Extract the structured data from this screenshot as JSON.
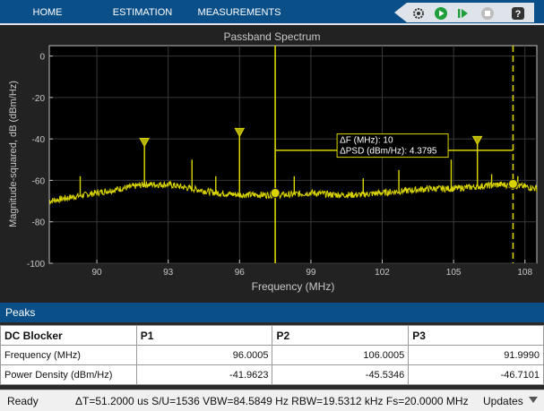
{
  "toolstrip": {
    "tabs": [
      "HOME",
      "ESTIMATION",
      "MEASUREMENTS"
    ],
    "quick_access": [
      "settings-icon",
      "run-icon",
      "step-forward-icon",
      "stop-icon",
      "help-icon"
    ]
  },
  "plot": {
    "title": "Passband Spectrum",
    "ylabel": "Magnitude-squared, dB (dBm/Hz)",
    "xlabel": "Frequency (MHz)",
    "delta_f_label": "ΔF (MHz): 10",
    "delta_psd_label": "ΔPSD (dBm/Hz): 4.3795",
    "colors": {
      "trace": "#d9d400",
      "axes": "#bfbfbf",
      "grid": "#3a3a3a",
      "background": "#000000"
    }
  },
  "chart_data": {
    "type": "line",
    "title": "Passband Spectrum",
    "xlabel": "Frequency (MHz)",
    "ylabel": "Magnitude-squared, dB (dBm/Hz)",
    "xlim": [
      88,
      108.5
    ],
    "ylim": [
      -100,
      5
    ],
    "xticks": [
      "90",
      "93",
      "96",
      "99",
      "102",
      "105",
      "108"
    ],
    "yticks": [
      "0",
      "-20",
      "-40",
      "-60",
      "-80",
      "-100"
    ],
    "grid": true,
    "cursors": [
      97.5,
      107.5
    ],
    "cursor_points": [
      [
        97.5,
        -66.1
      ],
      [
        107.5,
        -61.7
      ]
    ],
    "peak_markers": [
      [
        92.0,
        -42.3
      ],
      [
        96.0,
        -37.5
      ],
      [
        106.0,
        -41.4
      ]
    ],
    "spikes": [
      [
        89.3,
        -58
      ],
      [
        92.0,
        -43
      ],
      [
        94.0,
        -50
      ],
      [
        95.0,
        -58
      ],
      [
        96.0,
        -38
      ],
      [
        98.3,
        -58
      ],
      [
        101.2,
        -59
      ],
      [
        102.7,
        -55
      ],
      [
        104.9,
        -50
      ],
      [
        106.0,
        -42
      ],
      [
        106.6,
        -57
      ],
      [
        107.7,
        -58
      ]
    ],
    "baseline": [
      [
        88.0,
        -70
      ],
      [
        89.0,
        -68
      ],
      [
        90.0,
        -66
      ],
      [
        91.0,
        -64
      ],
      [
        92.0,
        -62
      ],
      [
        93.0,
        -62
      ],
      [
        94.0,
        -64
      ],
      [
        95.0,
        -66
      ],
      [
        96.0,
        -67
      ],
      [
        97.0,
        -67
      ],
      [
        98.0,
        -67
      ],
      [
        99.0,
        -66
      ],
      [
        100.0,
        -67
      ],
      [
        101.0,
        -67
      ],
      [
        102.0,
        -66
      ],
      [
        103.0,
        -65
      ],
      [
        104.0,
        -64
      ],
      [
        105.0,
        -64
      ],
      [
        106.0,
        -63
      ],
      [
        107.0,
        -62
      ],
      [
        108.0,
        -63
      ],
      [
        108.5,
        -64
      ]
    ]
  },
  "peaks_panel": {
    "title": "Peaks",
    "headers": [
      "DC Blocker",
      "P1",
      "P2",
      "P3"
    ],
    "rows": [
      {
        "label": "Frequency (MHz)",
        "values": [
          "96.0005",
          "106.0005",
          "91.9990"
        ]
      },
      {
        "label": "Power Density (dBm/Hz)",
        "values": [
          "-41.9623",
          "-45.5346",
          "-46.7101"
        ]
      }
    ]
  },
  "status": {
    "ready": "Ready",
    "info": "ΔT=51.2000 us  S/U=1536  VBW=84.5849 Hz  RBW=19.5312 kHz  Fs=20.0000 MHz",
    "updates": "Updates"
  }
}
